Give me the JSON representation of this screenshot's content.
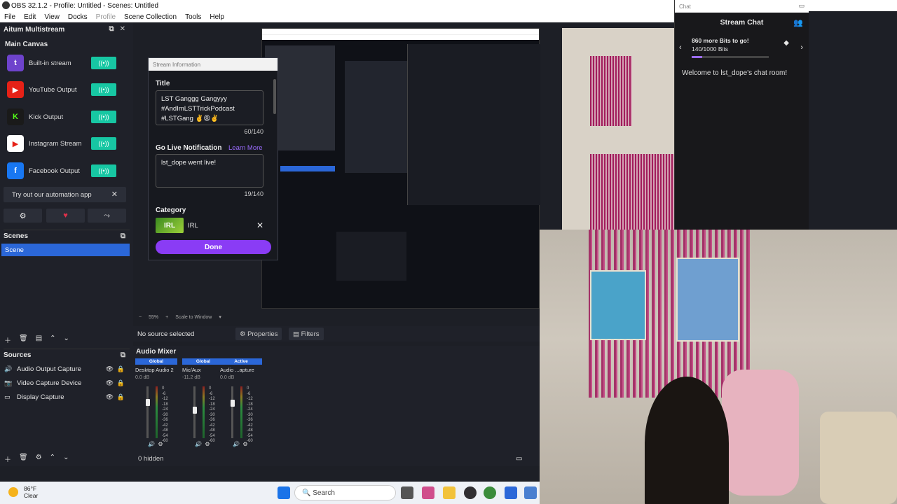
{
  "window": {
    "title": "OBS 32.1.2 - Profile: Untitled - Scenes: Untitled"
  },
  "menu": [
    "File",
    "Edit",
    "View",
    "Docks",
    "Profile",
    "Scene Collection",
    "Tools",
    "Help"
  ],
  "multistream": {
    "title": "Aitum Multistream",
    "section": "Main Canvas",
    "outputs": [
      {
        "label": "Built-in stream",
        "icon": "twitch-icon",
        "color": "#6e43cc",
        "glyph": "t"
      },
      {
        "label": "YouTube Output",
        "icon": "youtube-icon",
        "color": "#e62117",
        "glyph": "▶"
      },
      {
        "label": "Kick Output",
        "icon": "kick-icon",
        "color": "#1a1a1a",
        "glyph": "K"
      },
      {
        "label": "Instagram Stream",
        "icon": "instagram-icon",
        "color": "#ffffff",
        "glyph": "▶"
      },
      {
        "label": "Facebook Output",
        "icon": "facebook-icon",
        "color": "#1877f2",
        "glyph": "f"
      }
    ],
    "automation": "Try out our automation app"
  },
  "scenes": {
    "title": "Scenes",
    "items": [
      "Scene"
    ]
  },
  "sources": {
    "title": "Sources",
    "items": [
      "Audio Output Capture",
      "Video Capture Device",
      "Display Capture"
    ]
  },
  "stream_info": {
    "title": "Stream Information",
    "title_label": "Title",
    "title_value": "LST Ganggg Gangyyy\n#AndImLSTTrickPodcast\n#LSTGang ✌️😡✌️",
    "title_count": "60/140",
    "notif_label": "Go Live Notification",
    "learn_more": "Learn More",
    "notif_value": "lst_dope went live!",
    "notif_count": "19/140",
    "category_label": "Category",
    "category_value": "IRL",
    "done": "Done"
  },
  "preview_bar": {
    "zoom": "55%",
    "mode": "Scale to Window"
  },
  "context": {
    "no_source": "No source selected",
    "properties": "Properties",
    "filters": "Filters"
  },
  "mixer": {
    "title": "Audio Mixer",
    "channels": [
      {
        "badge": "Global",
        "name": "Desktop Audio 2",
        "db": "0.0 dB",
        "level": 0.72
      },
      {
        "badge": "Global",
        "name": "Mic/Aux",
        "db": "-11.2 dB",
        "level": 0.55
      },
      {
        "badge": "Active",
        "name": "Audio ...apture",
        "db": "0.0 dB",
        "level": 0.7
      }
    ],
    "scale": [
      "0",
      "-6",
      "-12",
      "-18",
      "-24",
      "-30",
      "-36",
      "-42",
      "-48",
      "-54",
      "-60"
    ],
    "hidden": "0 hidden"
  },
  "chat": {
    "dock_title": "Chat",
    "title": "Stream Chat",
    "bits_goal": "860 more Bits to go!",
    "bits_progress": "140/1000 Bits",
    "bits_fraction": 0.14,
    "welcome": "Welcome to lst_dope's chat room!"
  },
  "taskbar": {
    "temp": "86°F",
    "weather": "Clear",
    "search": "Search"
  }
}
